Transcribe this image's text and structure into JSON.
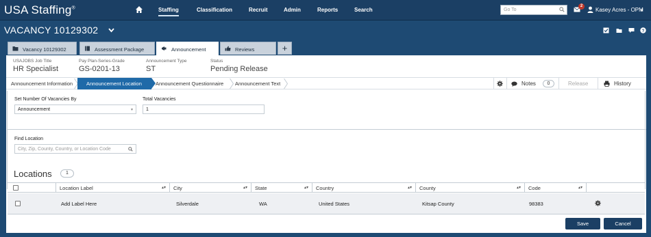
{
  "app": {
    "brand": "USA Staffing",
    "brand_mark": "®"
  },
  "nav": {
    "items": [
      "Staffing",
      "Classification",
      "Recruit",
      "Admin",
      "Reports",
      "Search"
    ],
    "active": "Staffing",
    "goto_placeholder": "Go To",
    "mail_count": "2",
    "user": "Kasey Acres - OPM"
  },
  "vacancy": {
    "title": "VACANCY 10129302"
  },
  "tabs": [
    {
      "label": "Vacancy 10129302",
      "icon": "folder-icon"
    },
    {
      "label": "Assessment Package",
      "icon": "book-icon"
    },
    {
      "label": "Announcement",
      "icon": "bullhorn-icon"
    },
    {
      "label": "Reviews",
      "icon": "thumbs-up-icon"
    }
  ],
  "tab_add": "+",
  "info": [
    {
      "label": "USAJOBS Job Title",
      "value": "HR Specialist"
    },
    {
      "label": "Pay Plan-Series-Grade",
      "value": "GS-0201-13"
    },
    {
      "label": "Announcement Type",
      "value": "ST"
    },
    {
      "label": "Status",
      "value": "Pending Release"
    }
  ],
  "steps": [
    "Announcement Information",
    "Announcement Location",
    "Announcement Questionnaire",
    "Announcement Text"
  ],
  "active_step": "Announcement Location",
  "actions": {
    "notes": "Notes",
    "notes_count": "0",
    "release": "Release",
    "history": "History"
  },
  "form": {
    "vacancies_by_label": "Set Number Of Vacancies By",
    "vacancies_by_value": "Announcement",
    "total_label": "Total Vacancies",
    "total_value": "1",
    "find_label": "Find Location",
    "find_placeholder": "City, Zip, County, Country, or Location Code"
  },
  "locations": {
    "title": "Locations",
    "count": "1",
    "columns": [
      "Location Label",
      "City",
      "State",
      "Country",
      "County",
      "Code"
    ],
    "rows": [
      {
        "label": "Add Label Here",
        "city": "Silverdale",
        "state": "WA",
        "country": "United States",
        "county": "Kitsap County",
        "code": "98383"
      }
    ]
  },
  "buttons": {
    "save": "Save",
    "cancel": "Cancel"
  },
  "colors": {
    "nav_bg": "#1b3f64",
    "accent": "#1f6aa8",
    "badge": "#c0392b"
  }
}
